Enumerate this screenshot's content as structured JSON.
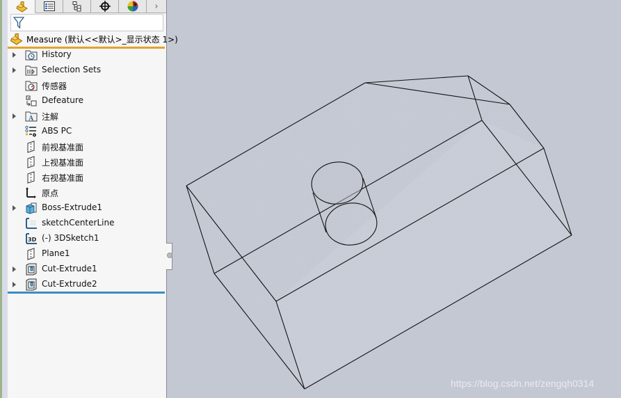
{
  "tabs": [
    {
      "name": "feature-manager",
      "icon": "part-icon",
      "active": true
    },
    {
      "name": "property-manager",
      "icon": "property-list-icon",
      "active": false
    },
    {
      "name": "configuration-manager",
      "icon": "configuration-icon",
      "active": false
    },
    {
      "name": "dimxpert-manager",
      "icon": "crosshair-icon",
      "active": false
    },
    {
      "name": "display-manager",
      "icon": "appearance-ball-icon",
      "active": false
    }
  ],
  "tab_more": "›",
  "filter": {
    "icon": "filter-icon",
    "value": ""
  },
  "root": {
    "label": "Measure  (默认<<默认>_显示状态 1>)",
    "icon": "part-icon"
  },
  "tree": [
    {
      "label": "History",
      "icon": "history-folder-icon",
      "expandable": true
    },
    {
      "label": "Selection Sets",
      "icon": "selection-sets-folder-icon",
      "expandable": true
    },
    {
      "label": "传感器",
      "icon": "sensors-folder-icon",
      "expandable": false
    },
    {
      "label": "Defeature",
      "icon": "defeature-icon",
      "expandable": false
    },
    {
      "label": "注解",
      "icon": "annotations-folder-icon",
      "expandable": true
    },
    {
      "label": "ABS PC",
      "icon": "material-icon",
      "expandable": false
    },
    {
      "label": "前视基准面",
      "icon": "plane-icon",
      "expandable": false
    },
    {
      "label": "上视基准面",
      "icon": "plane-icon",
      "expandable": false
    },
    {
      "label": "右视基准面",
      "icon": "plane-icon",
      "expandable": false
    },
    {
      "label": "原点",
      "icon": "origin-icon",
      "expandable": false
    },
    {
      "label": "Boss-Extrude1",
      "icon": "boss-extrude-icon",
      "expandable": true
    },
    {
      "label": "sketchCenterLine",
      "icon": "sketch-icon",
      "expandable": false
    },
    {
      "label": "(-) 3DSketch1",
      "icon": "3d-sketch-icon",
      "expandable": false
    },
    {
      "label": "Plane1",
      "icon": "plane-icon",
      "expandable": false
    },
    {
      "label": "Cut-Extrude1",
      "icon": "cut-extrude-icon",
      "expandable": true
    },
    {
      "label": "Cut-Extrude2",
      "icon": "cut-extrude-icon",
      "expandable": true
    }
  ],
  "colors": {
    "rollback_bar_top": "#e0a52c",
    "rollback_bar_bottom": "#3a8cc4",
    "viewport_bg": "#c4c8d3"
  },
  "watermark": "https://blog.csdn.net/zengqh0314"
}
